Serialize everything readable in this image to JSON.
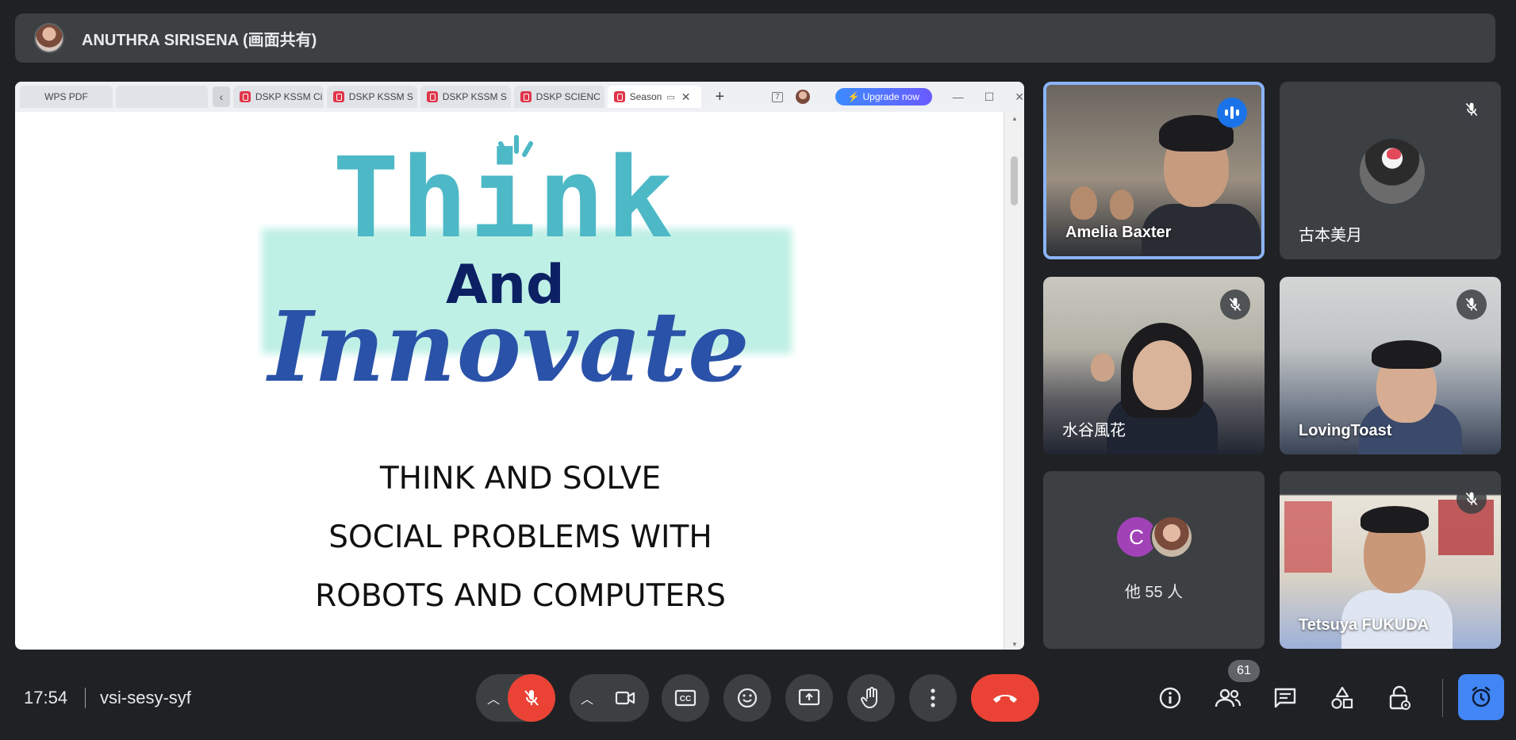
{
  "presenter": {
    "name": "ANUTHRA SIRISENA (画面共有)"
  },
  "browser": {
    "app_tab": "WPS PDF",
    "tabs": [
      {
        "label": "DSKP KSSM Ci"
      },
      {
        "label": "DSKP KSSM S"
      },
      {
        "label": "DSKP KSSM S"
      },
      {
        "label": "DSKP SCIENC"
      }
    ],
    "active_tab": "Season",
    "page_number": "7",
    "upgrade_label": "Upgrade now"
  },
  "slide": {
    "logo_line1": "Think",
    "logo_line2": "And",
    "logo_line3": "Innovate",
    "lines": [
      "THINK AND SOLVE",
      "SOCIAL PROBLEMS WITH",
      "ROBOTS AND COMPUTERS"
    ]
  },
  "participants": {
    "p1": {
      "name": "Amelia Baxter"
    },
    "p2": {
      "name": "古本美月"
    },
    "p3": {
      "name": "水谷風花"
    },
    "p4": {
      "name": "LovingToast"
    },
    "others": {
      "initial": "C",
      "label": "他 55 人"
    },
    "p6": {
      "name": "Tetsuya FUKUDA"
    }
  },
  "meeting": {
    "time": "17:54",
    "code": "vsi-sesy-syf",
    "participant_count": "61"
  },
  "colors": {
    "accent": "#8ab4f8",
    "mic_off": "#ea4335",
    "end_call": "#ea4335",
    "tile_bg": "#3c4043",
    "timer": "#4285f4"
  },
  "icons": {
    "mic": "mic-off-icon",
    "camera": "videocam-icon",
    "captions": "closed-caption-icon",
    "emoji": "emoji-icon",
    "present": "present-screen-icon",
    "hand": "raise-hand-icon",
    "more": "more-vert-icon",
    "end": "call-end-icon",
    "info": "info-icon",
    "people": "people-icon",
    "chat": "chat-icon",
    "activities": "activities-icon",
    "host": "host-controls-icon",
    "timer": "timer-icon"
  }
}
